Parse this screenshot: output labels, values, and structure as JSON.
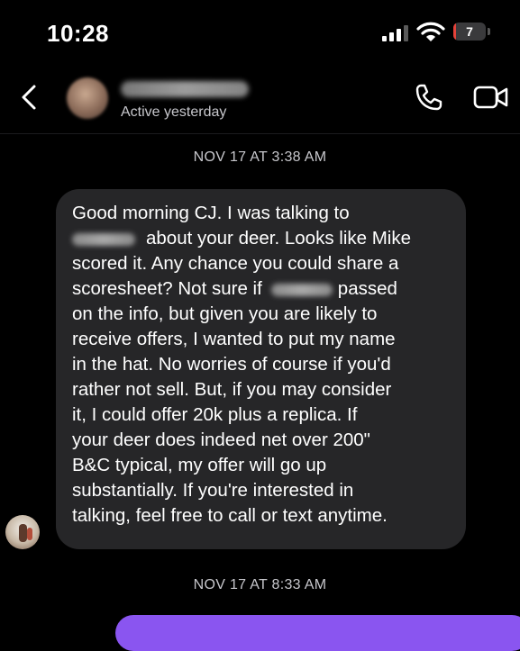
{
  "status_bar": {
    "time": "10:28",
    "battery_level": "7",
    "battery_fraction": 0.07,
    "battery_color": "#e5423a"
  },
  "header": {
    "back_icon": "chevron-left-icon",
    "status": "Active yesterday",
    "call_icon": "phone-icon",
    "video_icon": "video-camera-icon"
  },
  "thread": {
    "timestamps": [
      "NOV 17 AT 3:38 AM",
      "NOV 17 AT 8:33 AM"
    ],
    "message_lines": [
      "Good morning CJ.  I was talking to",
      "about your deer.  Looks like Mike",
      "scored it. Any chance you could share a",
      "scoresheet?  Not sure if",
      "passed",
      "on the info, but given you are likely to",
      "receive offers, I wanted to put my name",
      "in the hat.  No worries of course if you'd",
      "rather not sell.  But, if you may consider",
      "it, I could offer 20k plus a replica.  If",
      "your deer does indeed net over 200\"",
      "B&C typical, my offer will go up",
      "substantially.  If you're interested in",
      "talking, feel free to call or text anytime."
    ],
    "incoming_bubble_color": "#262628",
    "outgoing_bubble_color": "#8a55f0"
  }
}
